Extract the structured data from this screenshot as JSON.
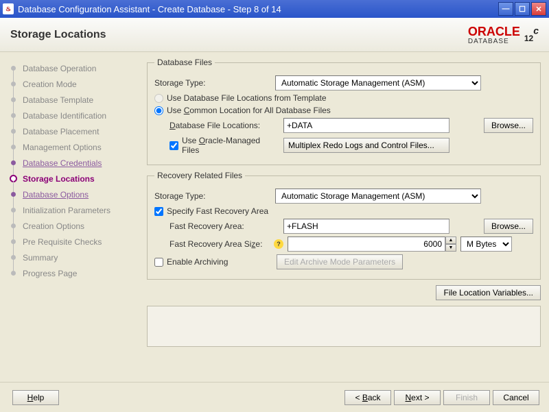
{
  "window": {
    "title": "Database Configuration Assistant - Create Database - Step 8 of 14"
  },
  "header": {
    "page_title": "Storage Locations",
    "brand": "ORACLE",
    "brand_sub": "DATABASE",
    "version": "12",
    "version_suffix": "c"
  },
  "sidebar": {
    "items": [
      {
        "label": "Database Operation",
        "state": "pending"
      },
      {
        "label": "Creation Mode",
        "state": "pending"
      },
      {
        "label": "Database Template",
        "state": "pending"
      },
      {
        "label": "Database Identification",
        "state": "pending"
      },
      {
        "label": "Database Placement",
        "state": "pending"
      },
      {
        "label": "Management Options",
        "state": "pending"
      },
      {
        "label": "Database Credentials",
        "state": "done"
      },
      {
        "label": "Storage Locations",
        "state": "active"
      },
      {
        "label": "Database Options",
        "state": "done"
      },
      {
        "label": "Initialization Parameters",
        "state": "pending"
      },
      {
        "label": "Creation Options",
        "state": "pending"
      },
      {
        "label": "Pre Requisite Checks",
        "state": "pending"
      },
      {
        "label": "Summary",
        "state": "pending"
      },
      {
        "label": "Progress Page",
        "state": "pending"
      }
    ]
  },
  "database_files": {
    "legend": "Database Files",
    "storage_type_label": "Storage Type:",
    "storage_type_value": "Automatic Storage Management (ASM)",
    "radio_template": "Use Database File Locations from Template",
    "radio_common": "Use Common Location for All Database Files",
    "loc_label": "Database File Locations:",
    "loc_value": "+DATA",
    "browse": "Browse...",
    "omf_check": "Use Oracle-Managed Files",
    "multiplex": "Multiplex Redo Logs and Control Files..."
  },
  "recovery": {
    "legend": "Recovery Related Files",
    "storage_type_label": "Storage Type:",
    "storage_type_value": "Automatic Storage Management (ASM)",
    "specify_fra": "Specify Fast Recovery Area",
    "fra_label": "Fast Recovery Area:",
    "fra_value": "+FLASH",
    "browse": "Browse...",
    "fra_size_label": "Fast Recovery Area Size:",
    "fra_size_value": "6000",
    "fra_size_unit": "M Bytes",
    "enable_arch": "Enable Archiving",
    "edit_arch": "Edit Archive Mode Parameters"
  },
  "file_loc_vars": "File Location Variables...",
  "footer": {
    "help": "Help",
    "back": "< Back",
    "next": "Next >",
    "finish": "Finish",
    "cancel": "Cancel"
  }
}
